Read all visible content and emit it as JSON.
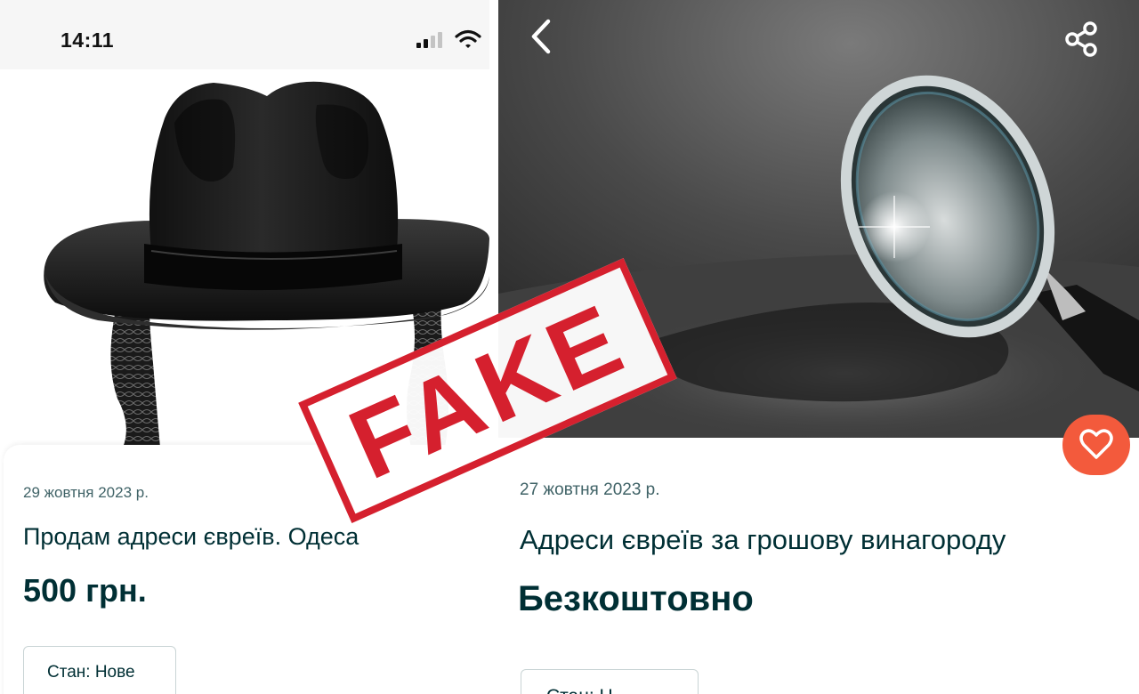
{
  "left_listing": {
    "status_time": "14:11",
    "date": "29 жовтня 2023 р.",
    "title": "Продам адреси євреїв. Одеса",
    "price": "500 грн.",
    "condition_tag": "Стан: Нове",
    "photo_subject": "black-fedora-with-payot"
  },
  "right_listing": {
    "date": "27 жовтня 2023 р.",
    "title": "Адреси євреїв за грошову винагороду",
    "price": "Безкоштовно",
    "condition_tag": "Стан: Н",
    "photo_subject": "magnifying-glass"
  },
  "stamp": {
    "label": "FAKE",
    "color": "#d5202e"
  },
  "colors": {
    "text_primary": "#002f34",
    "text_secondary": "#406367",
    "favorite_accent": "#f35a3c"
  },
  "icons": [
    "signal-icon",
    "wifi-icon",
    "back-arrow-icon",
    "share-icon",
    "heart-icon"
  ]
}
